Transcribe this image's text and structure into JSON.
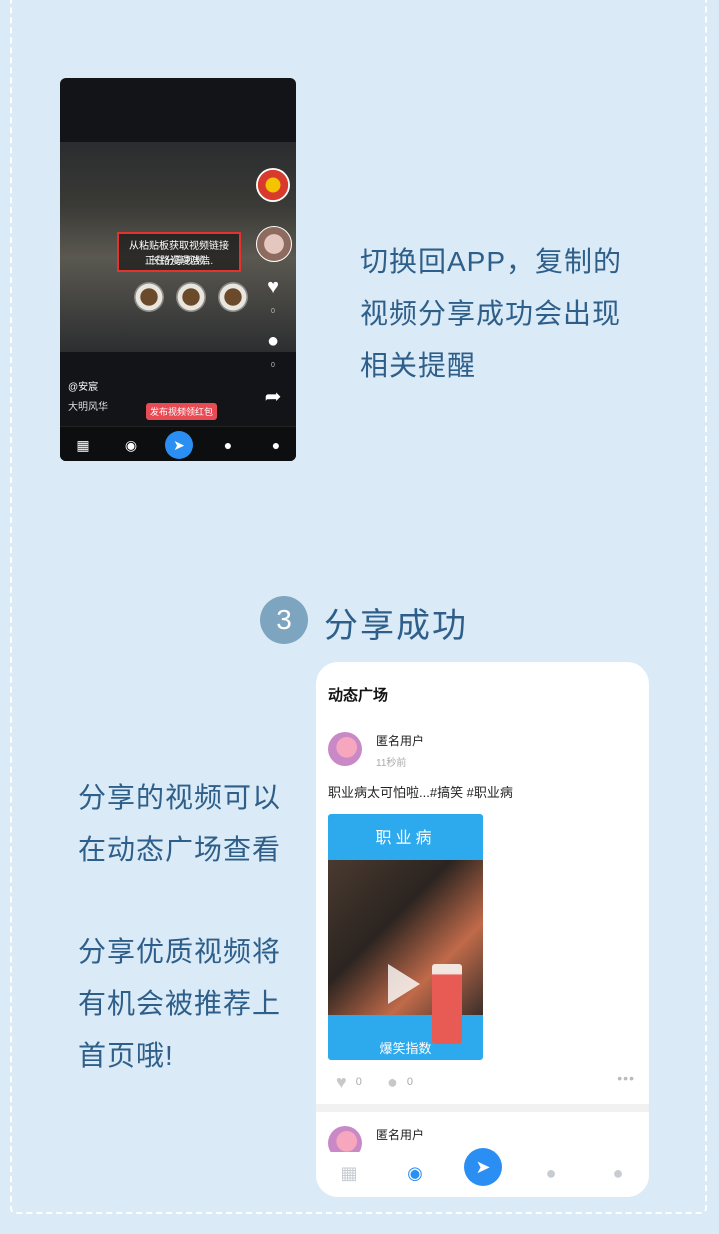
{
  "phone1": {
    "toast_line1": "从粘贴板获取视频链接",
    "toast_line2": "正在分享视频...",
    "video_caption": "长路漫漫浩浩",
    "like_count": "0",
    "comment_count": "0",
    "author": "@安宸",
    "music": "大明风华",
    "promo_pill": "发布视频领红包"
  },
  "step2": {
    "text_line1": "切换回APP，复制的",
    "text_line2": "视频分享成功会出现",
    "text_line3": "相关提醒"
  },
  "step3": {
    "number": "3",
    "title": "分享成功",
    "desc_line1": "分享的视频可以",
    "desc_line2": "在动态广场查看",
    "desc_line3": "分享优质视频将",
    "desc_line4": "有机会被推荐上",
    "desc_line5": "首页哦!"
  },
  "phone2": {
    "page_title": "动态广场",
    "post1": {
      "username": "匿名用户",
      "time": "11秒前",
      "text": "职业病太可怕啦...#搞笑 #职业病",
      "video_title": "职业病",
      "video_bottom": "爆笑指数",
      "likes": "0",
      "comments": "0"
    },
    "post2": {
      "username": "匿名用户"
    }
  },
  "colors": {
    "background": "#daeaf6",
    "accent": "#2b8ef3",
    "text": "#2e5f8a"
  }
}
